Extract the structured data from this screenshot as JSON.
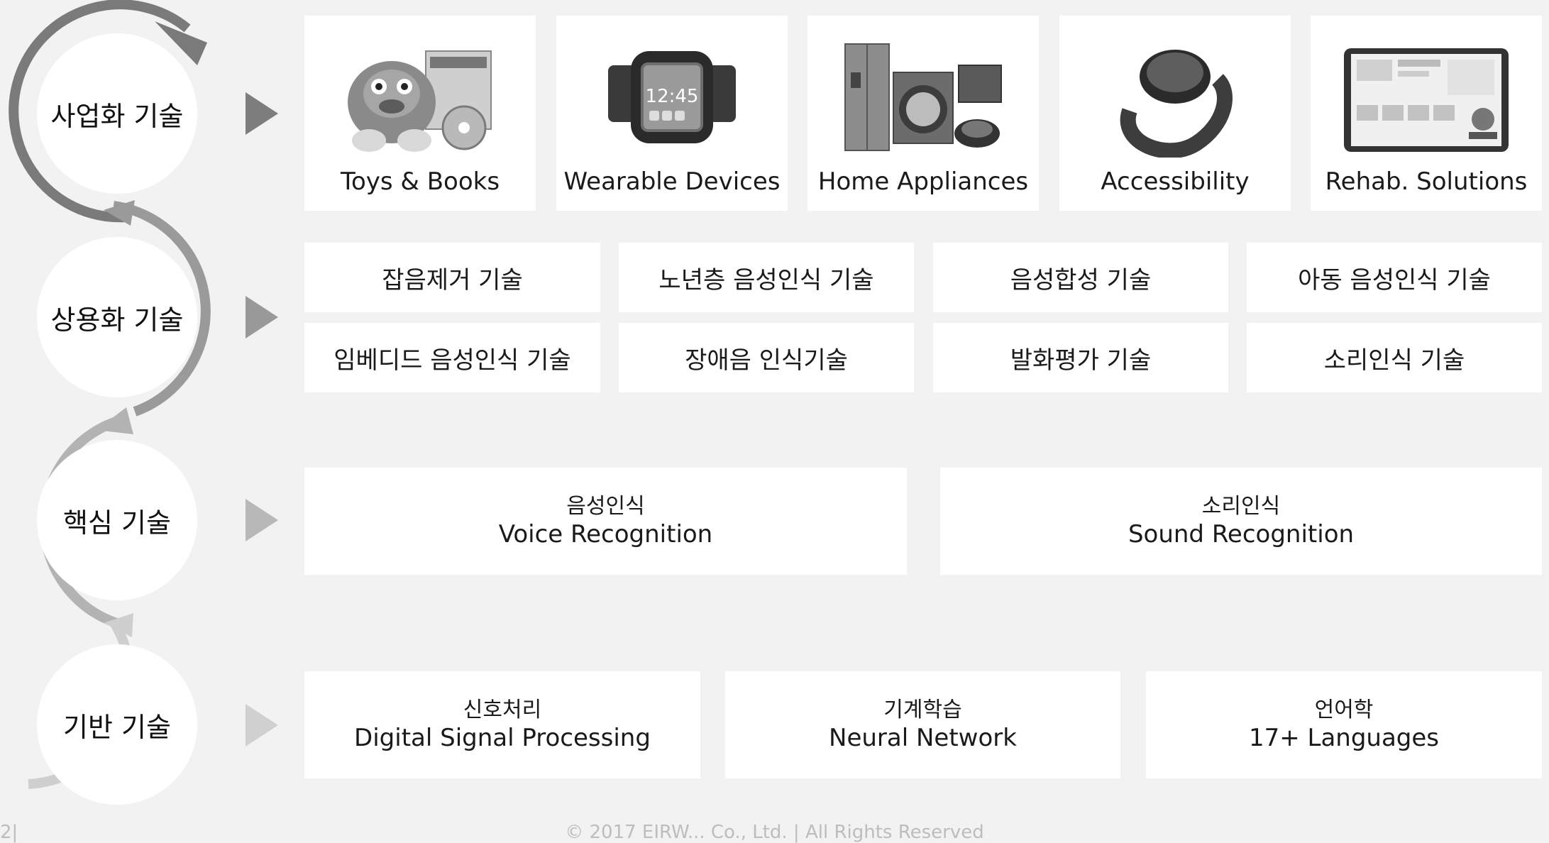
{
  "tiers": [
    {
      "label": "사업화 기술"
    },
    {
      "label": "상용화 기술"
    },
    {
      "label": "핵심 기술"
    },
    {
      "label": "기반 기술"
    }
  ],
  "colors": {
    "arc1": "#7a7a7a",
    "arc2": "#9a9a9a",
    "arc3": "#b3b3b3",
    "arc4": "#cfcfcf",
    "play1": "#7d7d7d",
    "play2": "#999999",
    "play3": "#b8b8b8",
    "play4": "#d0d0d0",
    "background": "#f2f2f2",
    "box": "#ffffff"
  },
  "products": [
    {
      "label": "Toys & Books",
      "icon": "toys-books-image"
    },
    {
      "label": "Wearable Devices",
      "icon": "smartwatch-image"
    },
    {
      "label": "Home Appliances",
      "icon": "home-appliances-image"
    },
    {
      "label": "Accessibility",
      "icon": "wristband-device-image"
    },
    {
      "label": "Rehab. Solutions",
      "icon": "tablet-app-image"
    }
  ],
  "commercial": [
    "잡음제거 기술",
    "노년층 음성인식 기술",
    "음성합성 기술",
    "아동 음성인식 기술",
    "임베디드 음성인식 기술",
    "장애음 인식기술",
    "발화평가 기술",
    "소리인식 기술"
  ],
  "core": [
    {
      "ko": "음성인식",
      "en": "Voice Recognition"
    },
    {
      "ko": "소리인식",
      "en": "Sound Recognition"
    }
  ],
  "base": [
    {
      "ko": "신호처리",
      "en": "Digital Signal Processing"
    },
    {
      "ko": "기계학습",
      "en": "Neural Network"
    },
    {
      "ko": "언어학",
      "en": "17+ Languages"
    }
  ],
  "footer": {
    "copyright": "© 2017 EIRW... Co., Ltd. | All Rights Reserved",
    "page_marker": "2|"
  }
}
